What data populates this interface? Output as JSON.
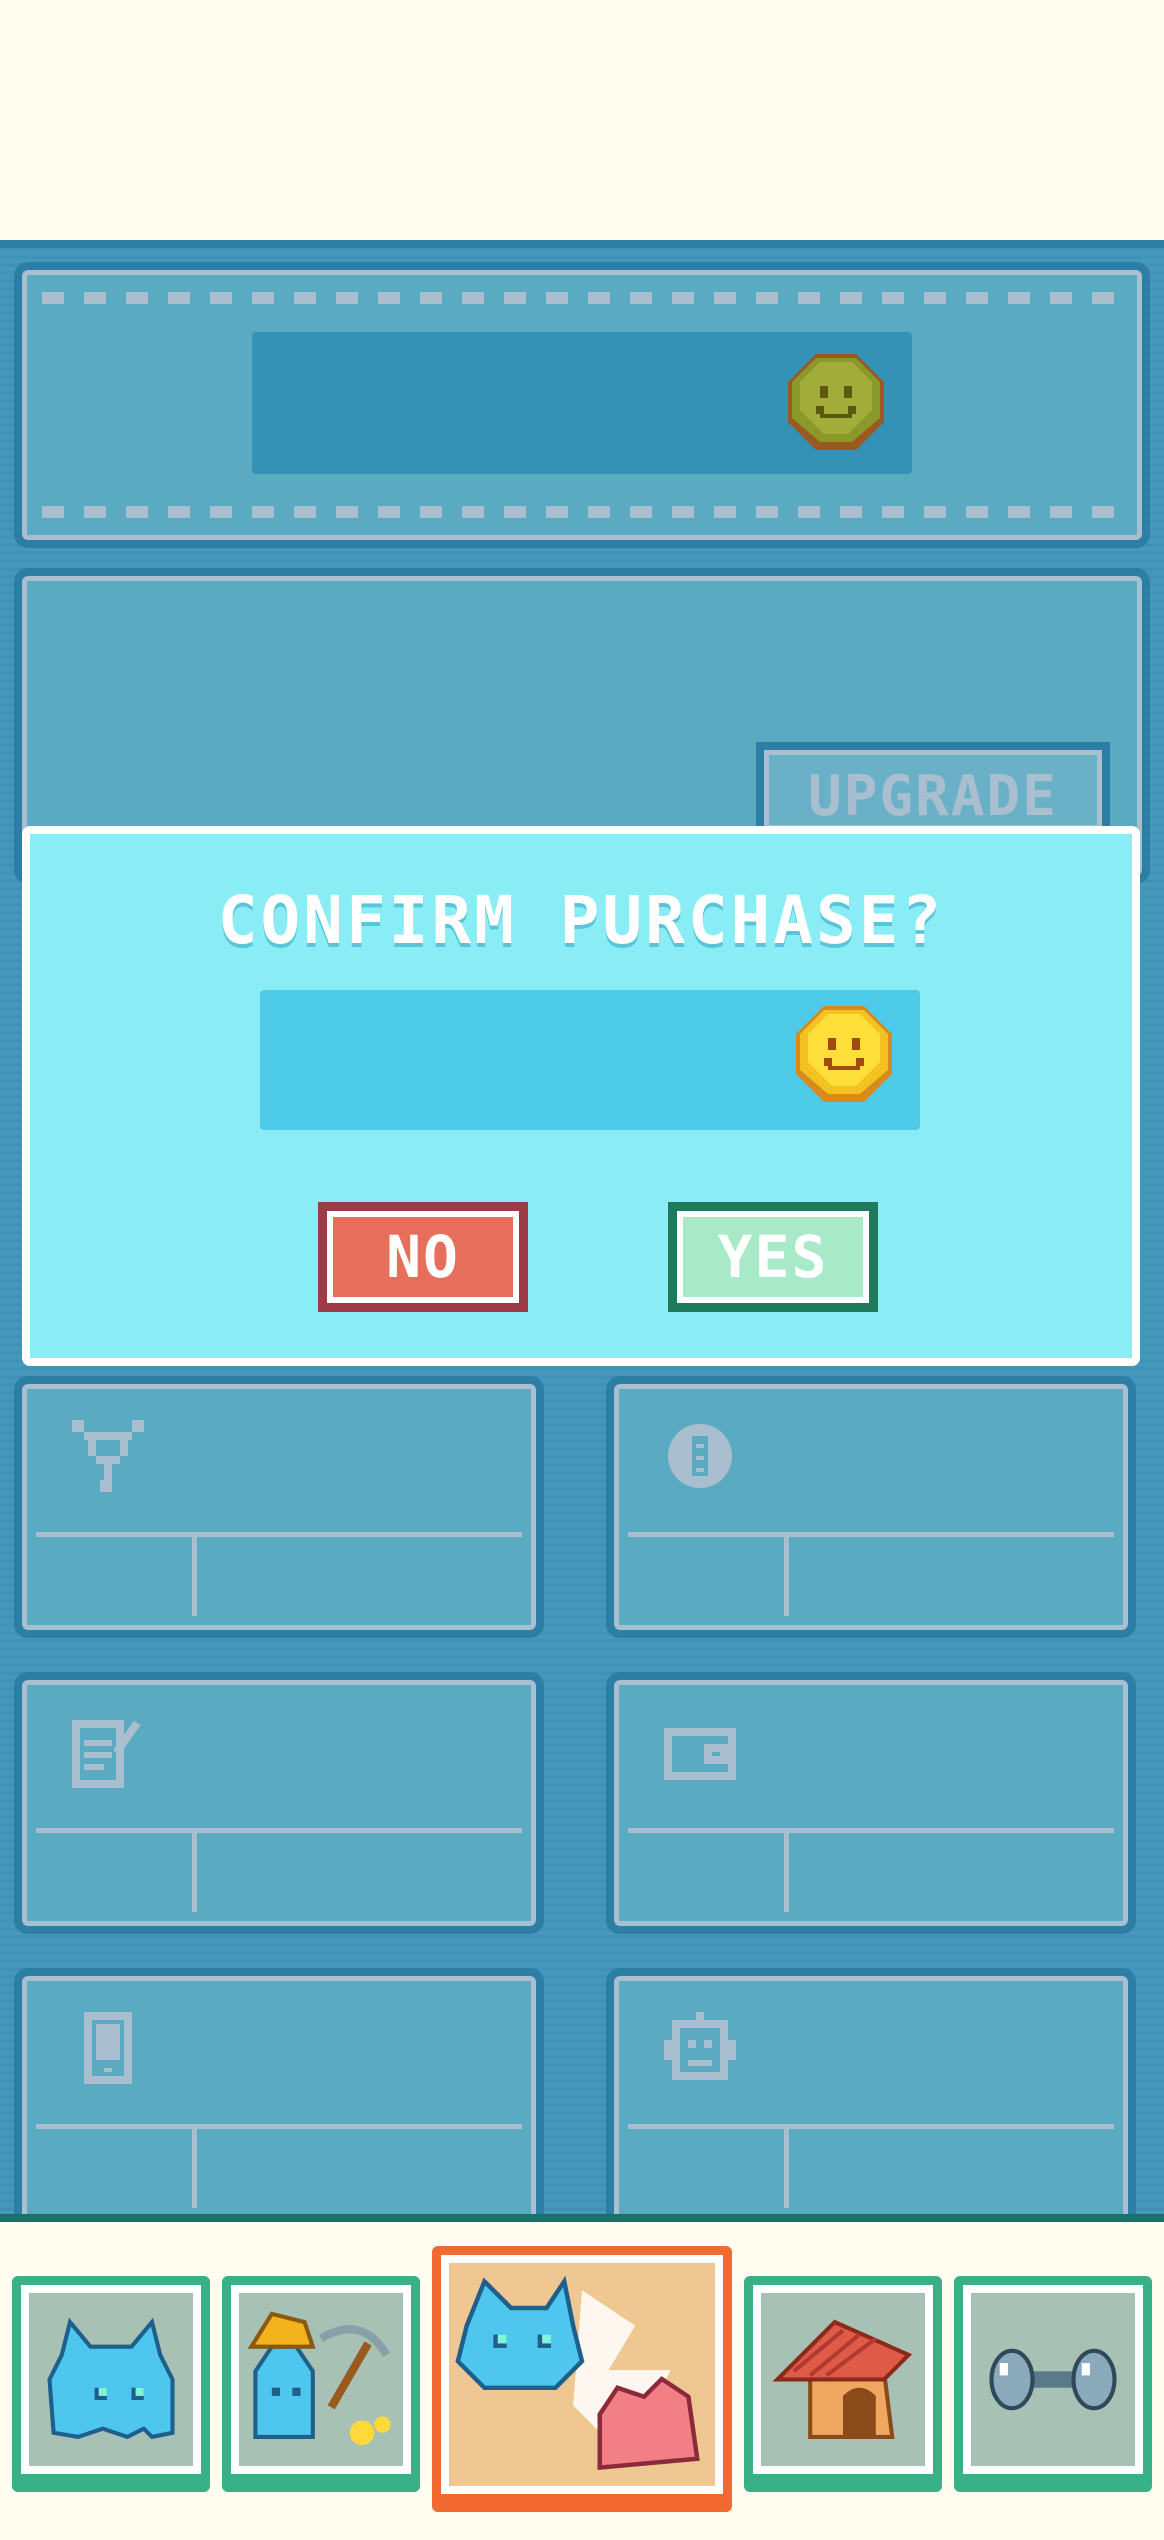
{
  "colors": {
    "background": "#3f93b8",
    "dialog": "#8aedf5",
    "no_button": "#e76e5a",
    "yes_button": "#a8e9c8",
    "active_tab": "#f26a32",
    "tab": "#39b086"
  },
  "header": {
    "currency_value": "",
    "coin_icon": "coin-icon"
  },
  "upgrade": {
    "button_label": "UPGRADE"
  },
  "dialog": {
    "title": "CONFIRM PURCHASE?",
    "price_value": "",
    "coin_icon": "coin-icon",
    "no_label": "NO",
    "yes_label": "YES"
  },
  "stats": [
    {
      "icon": "network-icon"
    },
    {
      "icon": "chip-icon"
    },
    {
      "icon": "notepad-icon"
    },
    {
      "icon": "wallet-icon"
    },
    {
      "icon": "phone-icon"
    },
    {
      "icon": "robot-icon"
    }
  ],
  "tabs": [
    {
      "icon": "pet-icon",
      "active": false
    },
    {
      "icon": "mining-icon",
      "active": false
    },
    {
      "icon": "battle-icon",
      "active": true
    },
    {
      "icon": "house-icon",
      "active": false
    },
    {
      "icon": "dumbbell-icon",
      "active": false
    }
  ]
}
